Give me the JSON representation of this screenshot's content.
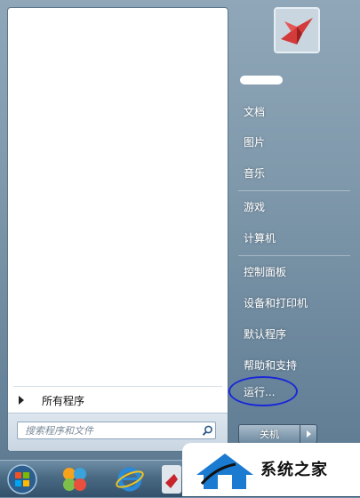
{
  "start_menu": {
    "all_programs_label": "所有程序",
    "search": {
      "placeholder": "搜索程序和文件"
    },
    "right_pane": {
      "items": [
        {
          "label": "文档"
        },
        {
          "label": "图片"
        },
        {
          "label": "音乐"
        },
        {
          "label": "游戏"
        },
        {
          "label": "计算机"
        },
        {
          "label": "控制面板"
        },
        {
          "label": "设备和打印机"
        },
        {
          "label": "默认程序"
        },
        {
          "label": "帮助和支持"
        },
        {
          "label": "运行..."
        }
      ],
      "shutdown_label": "关机"
    }
  },
  "watermark": {
    "text": "系统之家"
  },
  "colors": {
    "highlight_circle": "#1a28d8",
    "menu_bg": "#7f98ab",
    "taskbar_bg": "#4a6a84"
  }
}
